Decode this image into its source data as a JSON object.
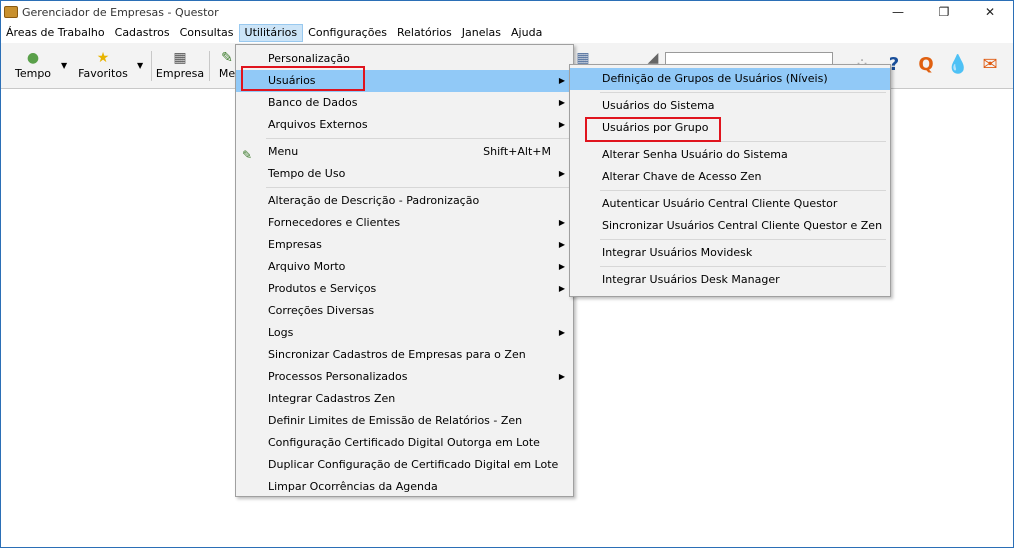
{
  "window": {
    "title": "Gerenciador de Empresas - Questor",
    "minimize": "—",
    "maximize": "❐",
    "close": "✕"
  },
  "menubar": [
    {
      "label": "Áreas de Trabalho"
    },
    {
      "label": "Cadastros"
    },
    {
      "label": "Consultas"
    },
    {
      "label": "Utilitários"
    },
    {
      "label": "Configurações"
    },
    {
      "label": "Relatórios"
    },
    {
      "label": "Janelas"
    },
    {
      "label": "Ajuda"
    }
  ],
  "toolbar": {
    "tempo": "Tempo",
    "favoritos": "Favoritos",
    "empresa": "Empresa",
    "menu_partial": "Me"
  },
  "utilitarios_menu": [
    {
      "label": "Personalização"
    },
    {
      "label": "Usuários"
    },
    {
      "label": "Banco de Dados"
    },
    {
      "label": "Arquivos Externos"
    },
    {
      "label": "Menu",
      "shortcut": "Shift+Alt+M"
    },
    {
      "label": "Tempo de Uso"
    },
    {
      "label": "Alteração de Descrição - Padronização"
    },
    {
      "label": "Fornecedores e Clientes"
    },
    {
      "label": "Empresas"
    },
    {
      "label": "Arquivo Morto"
    },
    {
      "label": "Produtos e Serviços"
    },
    {
      "label": "Correções Diversas"
    },
    {
      "label": "Logs"
    },
    {
      "label": "Sincronizar Cadastros de Empresas para o Zen"
    },
    {
      "label": "Processos Personalizados"
    },
    {
      "label": "Integrar Cadastros Zen"
    },
    {
      "label": "Definir Limites de Emissão de Relatórios - Zen"
    },
    {
      "label": "Configuração Certificado Digital Outorga em Lote"
    },
    {
      "label": "Duplicar Configuração de Certificado Digital em Lote"
    },
    {
      "label": "Limpar Ocorrências da Agenda"
    }
  ],
  "usuarios_submenu": [
    {
      "label": "Definição de Grupos de Usuários (Níveis)"
    },
    {
      "label": "Usuários do Sistema"
    },
    {
      "label": "Usuários por Grupo"
    },
    {
      "label": "Alterar Senha Usuário do Sistema"
    },
    {
      "label": "Alterar Chave de Acesso Zen"
    },
    {
      "label": "Autenticar Usuário Central Cliente Questor"
    },
    {
      "label": "Sincronizar Usuários Central Cliente Questor e Zen"
    },
    {
      "label": "Integrar Usuários Movidesk"
    },
    {
      "label": "Integrar Usuários Desk Manager"
    }
  ],
  "colors": {
    "highlight": "#91c9f7",
    "annotation": "#e0141e",
    "active_menu": "#cce4f7"
  }
}
